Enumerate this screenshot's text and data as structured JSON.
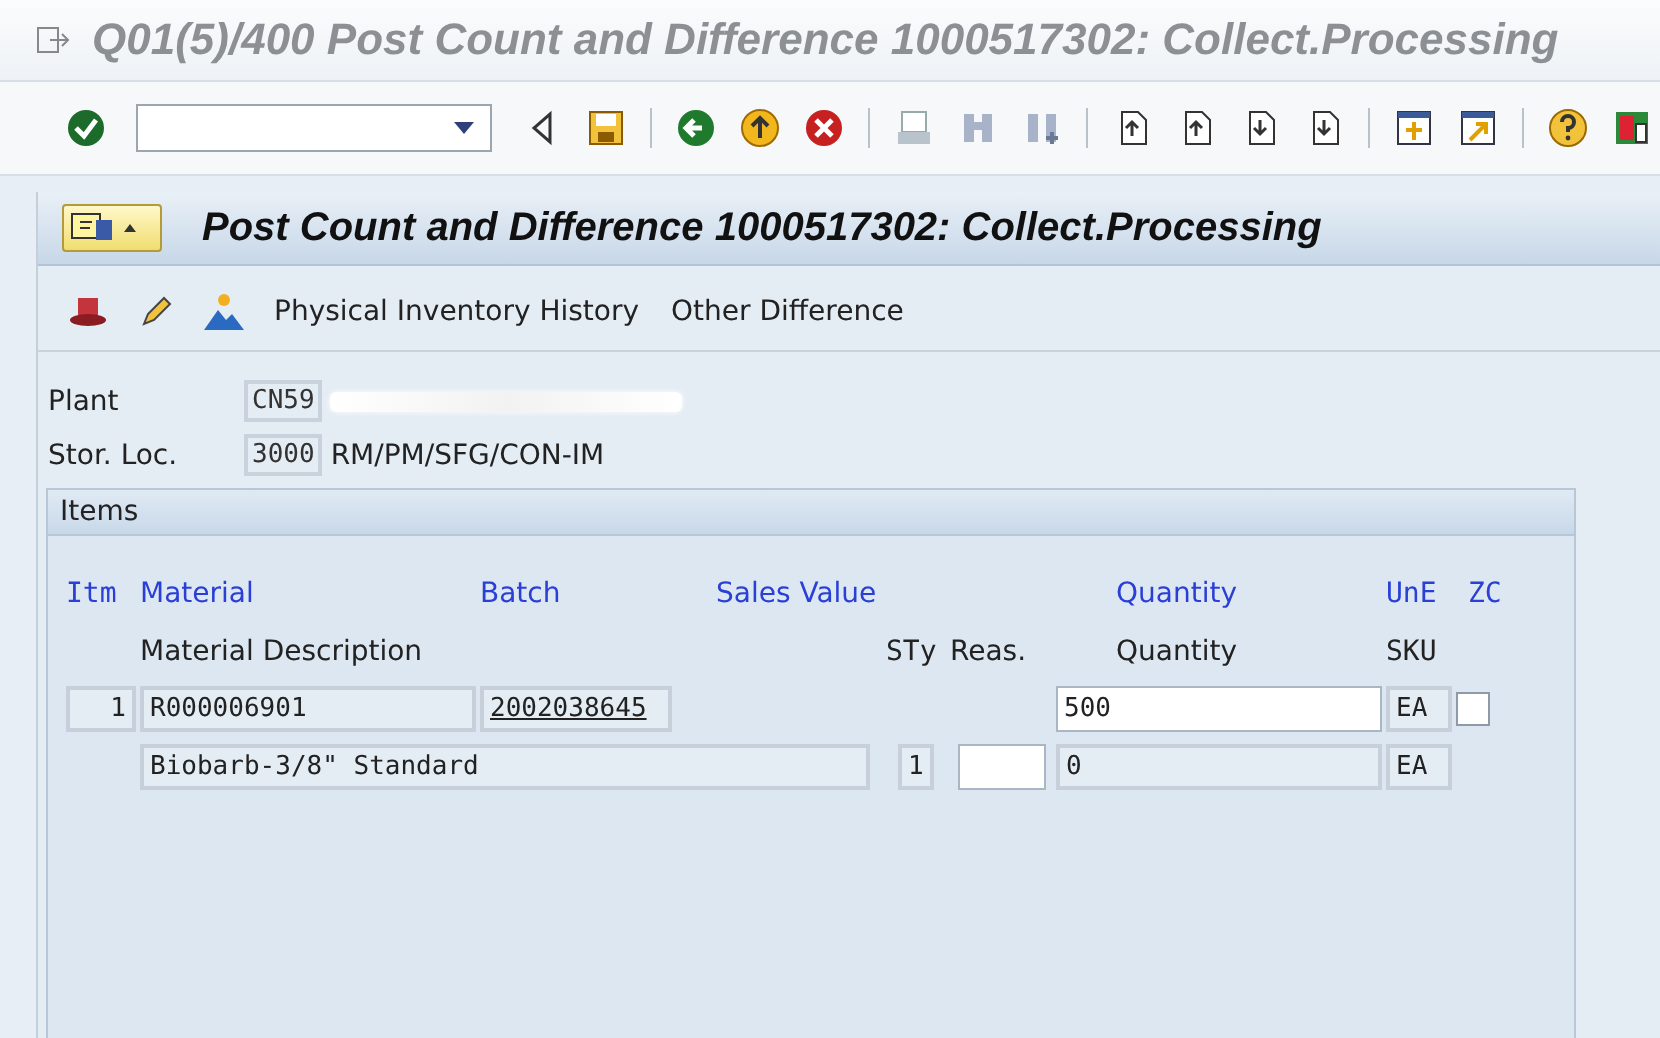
{
  "window": {
    "title": "Q01(5)/400 Post Count and Difference 1000517302: Collect.Processing"
  },
  "header": {
    "title": "Post Count and Difference 1000517302: Collect.Processing"
  },
  "app_toolbar": {
    "buttons": [
      "Physical Inventory History",
      "Other Difference"
    ]
  },
  "fields": [
    {
      "label": "Plant",
      "value": "CN59",
      "redacted": true
    },
    {
      "label": "Stor. Loc.",
      "value": "3000",
      "description": "RM/PM/SFG/CON-IM",
      "redacted": false
    }
  ],
  "items": {
    "title": "Items",
    "header_1": [
      "Itm",
      "Material",
      "Batch",
      "Sales Value",
      "Quantity",
      "UnE",
      "ZC"
    ],
    "header_2": [
      "Material Description",
      "STy",
      "Reas.",
      "Quantity",
      "SKU"
    ],
    "rows": [
      {
        "item": "1",
        "material": "R000006901",
        "batch": "2002038645",
        "quantity": "500",
        "unit": "EA",
        "zc_checked": false,
        "description": "Biobarb-3/8\" Standard",
        "stock_type": "1",
        "book_quantity": "0",
        "book_unit": "EA"
      }
    ]
  }
}
